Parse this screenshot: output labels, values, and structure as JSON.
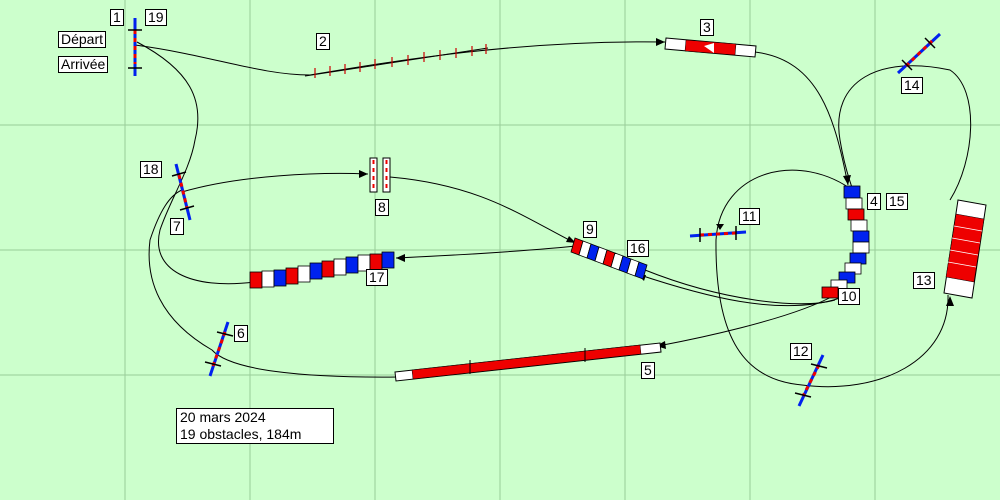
{
  "course": {
    "labels": {
      "depart": "Départ",
      "arrivee": "Arrivée",
      "n1": "1",
      "n2": "2",
      "n3": "3",
      "n4": "4",
      "n5": "5",
      "n6": "6",
      "n7": "7",
      "n8": "8",
      "n9": "9",
      "n10": "10",
      "n11": "11",
      "n12": "12",
      "n13": "13",
      "n14": "14",
      "n15": "15",
      "n16": "16",
      "n17": "17",
      "n18": "18",
      "n19": "19"
    },
    "info": {
      "date": "20  mars 2024",
      "summary": "19  obstacles, 184m"
    },
    "colors": {
      "field": "#ccffcc",
      "grid": "#99cc99",
      "red": "#ee0000",
      "blue": "#0022ee",
      "white": "#ffffff"
    }
  }
}
